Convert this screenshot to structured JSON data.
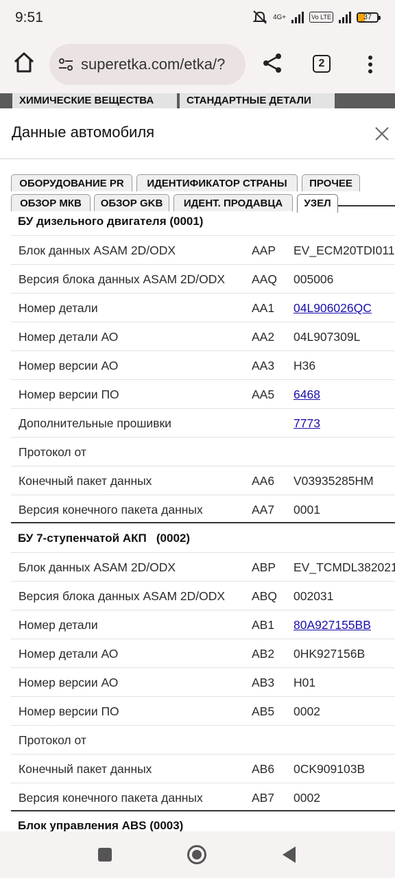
{
  "status_bar": {
    "time": "9:51",
    "network": "4G+",
    "volte": "Vo LTE",
    "battery": "37",
    "battery_level": 0.37
  },
  "browser": {
    "url": "superetka.com/etka/?",
    "tab_count": "2"
  },
  "behind_tabs": [
    "ХИМИЧЕСКИЕ ВЕЩЕСТВА",
    "СТАНДАРТНЫЕ ДЕТАЛИ"
  ],
  "modal": {
    "title": "Данные автомобиля",
    "tabs_row1": [
      "ОБОРУДОВАНИЕ PR",
      "ИДЕНТИФИКАТОР СТРАНЫ",
      "ПРОЧЕЕ"
    ],
    "tabs_row2": [
      "ОБЗОР МКВ",
      "ОБЗОР GKB",
      "ИДЕНТ. ПРОДАВЦА",
      "УЗЕЛ"
    ],
    "active_tab": "УЗЕЛ",
    "sections": [
      {
        "title": "БУ дизельного двигателя (0001)",
        "rows": [
          {
            "name": "Блок данных ASAM 2D/ODX",
            "code": "AAP",
            "value": "EV_ECM20TDI011"
          },
          {
            "name": "Версия блока данных ASAM 2D/ODX",
            "code": "AAQ",
            "value": "005006"
          },
          {
            "name": "Номер детали",
            "code": "AA1",
            "value": "04L906026QC"
          },
          {
            "name": "Номер детали АО",
            "code": "AA2",
            "value": "04L907309L"
          },
          {
            "name": "Номер версии АО",
            "code": "AA3",
            "value": "H36"
          },
          {
            "name": "Номер версии ПО",
            "code": "AA5",
            "value": "6468"
          },
          {
            "name": "Дополнительные прошивки",
            "code": "",
            "value": "7773"
          },
          {
            "name": "Протокол от",
            "code": "",
            "value": ""
          },
          {
            "name": "Конечный пакет данных",
            "code": "AA6",
            "value": "V03935285HM"
          },
          {
            "name": "Версия конечного пакета данных",
            "code": "AA7",
            "value": "0001"
          }
        ]
      },
      {
        "title": "БУ 7-ступенчатой АКП   (0002)",
        "rows": [
          {
            "name": "Блок данных ASAM 2D/ODX",
            "code": "ABP",
            "value": "EV_TCMDL382021"
          },
          {
            "name": "Версия блока данных ASAM 2D/ODX",
            "code": "ABQ",
            "value": "002031"
          },
          {
            "name": "Номер детали",
            "code": "AB1",
            "value": "80A927155BB"
          },
          {
            "name": "Номер детали АО",
            "code": "AB2",
            "value": "0HK927156B"
          },
          {
            "name": "Номер версии АО",
            "code": "AB3",
            "value": "H01"
          },
          {
            "name": "Номер версии ПО",
            "code": "AB5",
            "value": "0002"
          },
          {
            "name": "Протокол от",
            "code": "",
            "value": ""
          },
          {
            "name": "Конечный пакет данных",
            "code": "AB6",
            "value": "0CK909103B"
          },
          {
            "name": "Версия конечного пакета данных",
            "code": "AB7",
            "value": "0002"
          }
        ]
      },
      {
        "title": "Блок управления ABS (0003)",
        "rows": []
      }
    ]
  }
}
